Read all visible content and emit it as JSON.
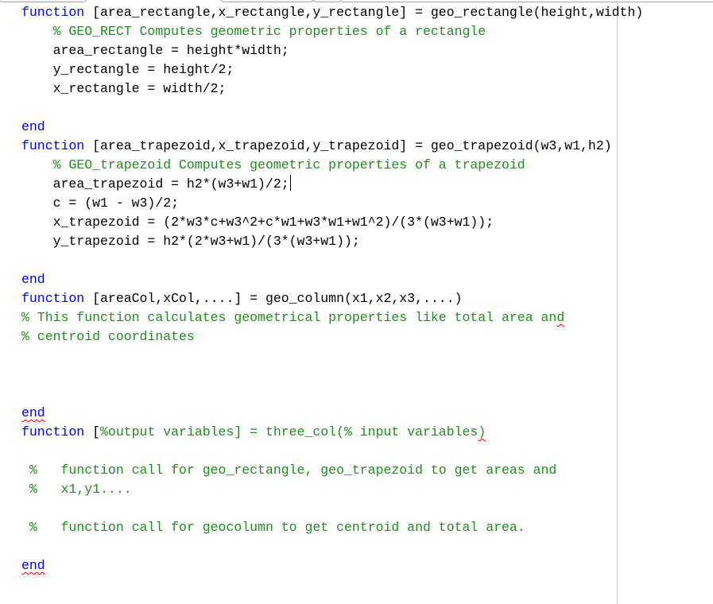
{
  "editor": {
    "colors": {
      "keyword": "#0000ff",
      "comment": "#228b22",
      "text": "#000000",
      "error_squiggle": "#ff0000"
    },
    "lines": [
      {
        "indent": "",
        "segments": [
          {
            "t": "kw",
            "v": "function"
          },
          {
            "t": "tx",
            "v": " [area_rectangle,x_rectangle,y_rectangle] = geo_rectangle(height,width)"
          }
        ]
      },
      {
        "indent": "    ",
        "segments": [
          {
            "t": "cm",
            "v": "% GEO_RECT Computes geometric properties of a rectangle"
          }
        ]
      },
      {
        "indent": "    ",
        "segments": [
          {
            "t": "tx",
            "v": "area_rectangle = height*width;"
          }
        ]
      },
      {
        "indent": "    ",
        "segments": [
          {
            "t": "tx",
            "v": "y_rectangle = height/2;"
          }
        ]
      },
      {
        "indent": "    ",
        "segments": [
          {
            "t": "tx",
            "v": "x_rectangle = width/2;"
          }
        ]
      },
      {
        "indent": "",
        "segments": []
      },
      {
        "indent": "",
        "segments": [
          {
            "t": "kw",
            "v": "end"
          }
        ]
      },
      {
        "indent": "",
        "segments": [
          {
            "t": "kw",
            "v": "function"
          },
          {
            "t": "tx",
            "v": " [area_trapezoid,x_trapezoid,y_trapezoid] = geo_trapezoid(w3,w1,h2)"
          }
        ]
      },
      {
        "indent": "    ",
        "segments": [
          {
            "t": "cm",
            "v": "% GEO_trapezoid Computes geometric properties of a trapezoid"
          }
        ]
      },
      {
        "indent": "    ",
        "segments": [
          {
            "t": "tx",
            "v": "area_trapezoid = h2*(w3+w1)/2;"
          }
        ],
        "cursor": true
      },
      {
        "indent": "    ",
        "segments": [
          {
            "t": "tx",
            "v": "c = (w1 - w3)/2;"
          }
        ]
      },
      {
        "indent": "    ",
        "segments": [
          {
            "t": "tx",
            "v": "x_trapezoid = (2*w3*c+w3^2+c*w1+w3*w1+w1^2)/(3*(w3+w1));"
          }
        ]
      },
      {
        "indent": "    ",
        "segments": [
          {
            "t": "tx",
            "v": "y_trapezoid = h2*(2*w3+w1)/(3*(w3+w1));"
          }
        ]
      },
      {
        "indent": "",
        "segments": []
      },
      {
        "indent": "",
        "segments": [
          {
            "t": "kw",
            "v": "end"
          }
        ]
      },
      {
        "indent": "",
        "segments": [
          {
            "t": "kw",
            "v": "function"
          },
          {
            "t": "tx",
            "v": " [areaCol,xCol,....] = geo_column(x1,x2,x3,....)"
          }
        ]
      },
      {
        "indent": "",
        "segments": [
          {
            "t": "cm",
            "v": "% This function calculates geometrical properties like total area an"
          },
          {
            "t": "cm",
            "v": "d",
            "squiggle": true
          }
        ]
      },
      {
        "indent": "",
        "segments": [
          {
            "t": "cm",
            "v": "% centroid coordinates"
          }
        ]
      },
      {
        "indent": "",
        "segments": []
      },
      {
        "indent": "",
        "segments": []
      },
      {
        "indent": "",
        "segments": []
      },
      {
        "indent": "",
        "segments": [
          {
            "t": "kw",
            "v": "end",
            "squiggle": true
          }
        ]
      },
      {
        "indent": "",
        "segments": [
          {
            "t": "kw",
            "v": "function"
          },
          {
            "t": "tx",
            "v": " ["
          },
          {
            "t": "cm",
            "v": "%output variables] = three_col(% input variables"
          },
          {
            "t": "cm",
            "v": ")",
            "squiggle": true
          }
        ]
      },
      {
        "indent": "",
        "segments": []
      },
      {
        "indent": " ",
        "segments": [
          {
            "t": "cm",
            "v": "%   function call for geo_rectangle, geo_trapezoid to get areas and"
          }
        ]
      },
      {
        "indent": " ",
        "segments": [
          {
            "t": "cm",
            "v": "%   x1,y1...."
          }
        ]
      },
      {
        "indent": "",
        "segments": []
      },
      {
        "indent": " ",
        "segments": [
          {
            "t": "cm",
            "v": "%   function call for geocolumn to get centroid and total area."
          }
        ]
      },
      {
        "indent": "",
        "segments": []
      },
      {
        "indent": "",
        "segments": [
          {
            "t": "kw",
            "v": "end",
            "squiggle": true
          }
        ]
      }
    ]
  }
}
